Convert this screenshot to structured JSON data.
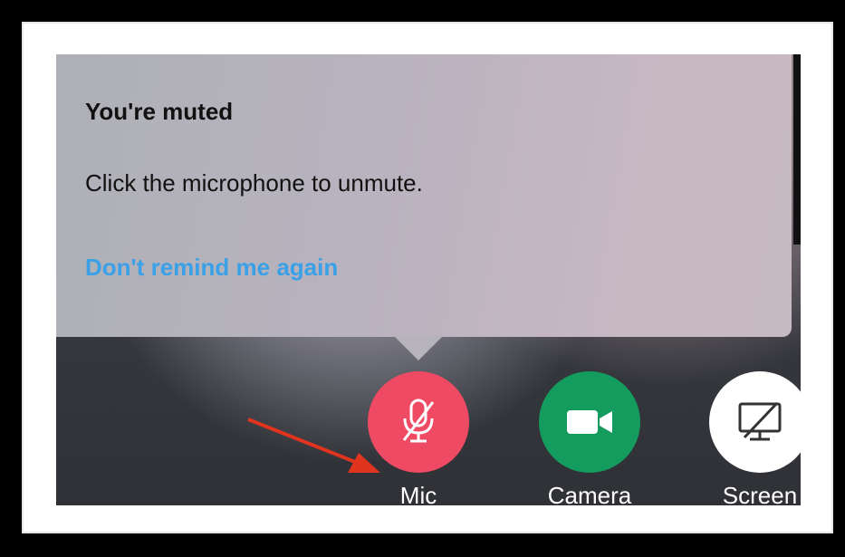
{
  "tooltip": {
    "title": "You're muted",
    "body": "Click the microphone to unmute.",
    "link": "Don't remind me again"
  },
  "controls": [
    {
      "label": "Mic",
      "icon": "mic-muted-icon",
      "color": "#ef4a63"
    },
    {
      "label": "Camera",
      "icon": "video-camera-icon",
      "color": "#149c5f"
    },
    {
      "label": "Screen",
      "icon": "screen-share-off-icon",
      "color": "#ffffff"
    }
  ],
  "colors": {
    "link": "#3aa0e8",
    "arrow": "#e0341f",
    "frame": "#000000"
  }
}
